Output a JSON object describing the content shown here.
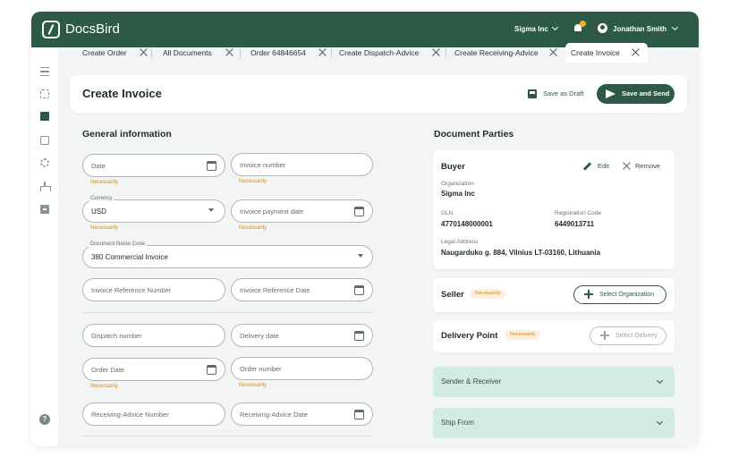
{
  "app": {
    "brand": "DocsBird",
    "company": "Sigma Inc",
    "user": "Jonathan Smith"
  },
  "tabs": [
    {
      "label": "Create Order"
    },
    {
      "label": "All Documents"
    },
    {
      "label": "Order 64846654"
    },
    {
      "label": "Create Dispatch-Advice"
    },
    {
      "label": "Create Receiving-Advice"
    },
    {
      "label": "Create Invoice"
    }
  ],
  "header": {
    "title": "Create Invoice",
    "save_draft": "Save as Draft",
    "save_send": "Save and Send"
  },
  "general": {
    "title": "General information",
    "date_ph": "Date",
    "invoice_number_ph": "Invoice number",
    "necessarily": "Necessarily",
    "currency_legend": "Currency",
    "currency_value": "USD",
    "payment_date_ph": "Invoice payment date",
    "doc_name_legend": "Document Name Code",
    "doc_name_value": "380 Commercial Invoice",
    "ref_number_ph": "Invoice Reference Number",
    "ref_date_ph": "Invoice Reference Date",
    "dispatch_number_ph": "Dispatch number",
    "delivery_date_ph": "Delivery date",
    "order_date_ph": "Order Date",
    "order_number_ph": "Order number",
    "ra_number_ph": "Receiving-Advice Number",
    "ra_date_ph": "Receiving-Advice Date"
  },
  "parties": {
    "title": "Document Parties",
    "buyer": {
      "title": "Buyer",
      "edit": "Edit",
      "remove": "Remove",
      "org_label": "Organization",
      "org_value": "Sigma Inc",
      "gln_label": "GLN",
      "gln_value": "4770148000001",
      "reg_label": "Registration Code",
      "reg_value": "6449013711",
      "addr_label": "Legal Address",
      "addr_value": "Naugarduko g. 884, Vilnius LT-03160, Lithuania"
    },
    "seller": {
      "title": "Seller",
      "badge": "Necessarily",
      "action": "Select Organization"
    },
    "delivery": {
      "title": "Delivery Point",
      "badge": "Necessarily",
      "action": "Select Delivery"
    },
    "sender_receiver": "Sender & Receiver",
    "ship_from": "Ship From"
  },
  "colors": {
    "brand": "#2c5a44",
    "warning": "#d08a1a",
    "accordion": "#d2ebe2"
  }
}
